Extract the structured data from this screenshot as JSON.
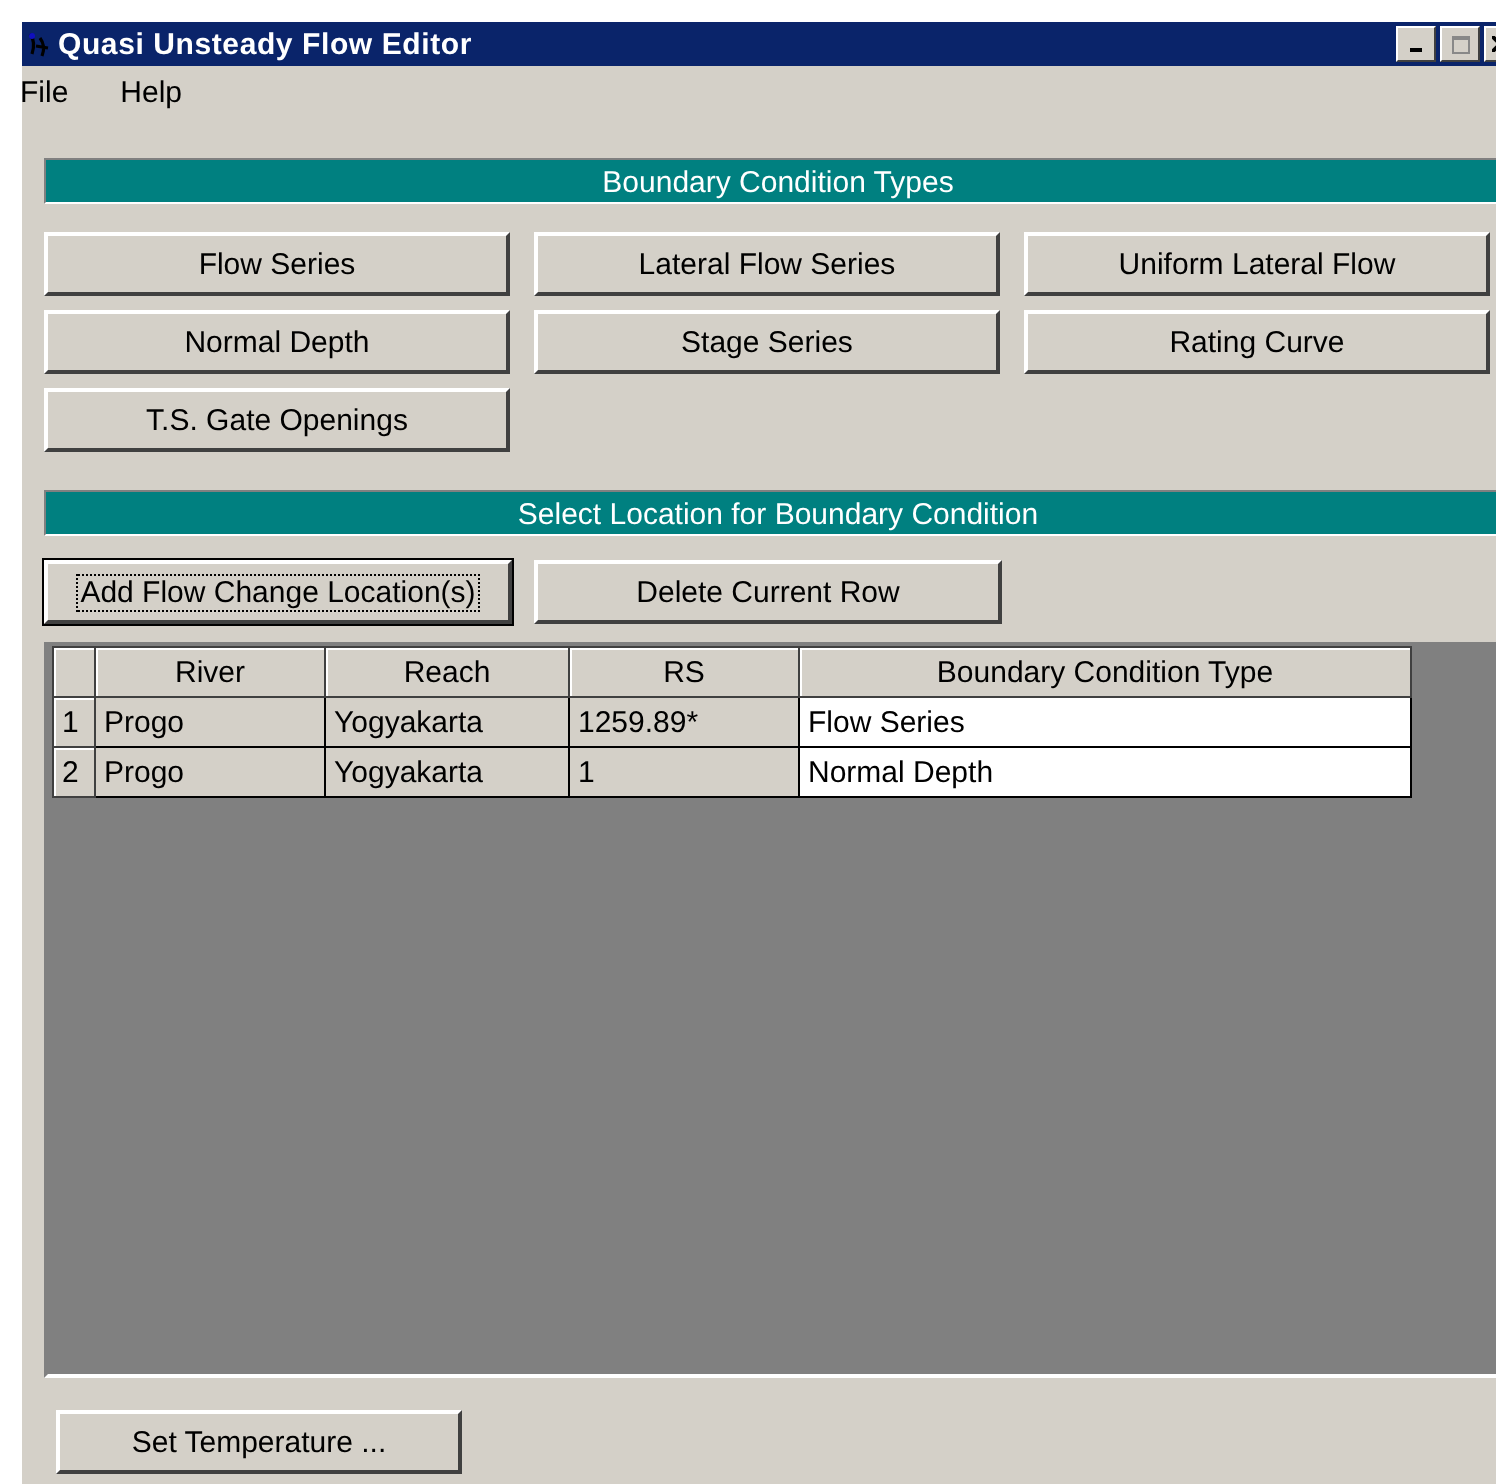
{
  "window": {
    "title": "Quasi Unsteady Flow Editor"
  },
  "menu": [
    "File",
    "Help"
  ],
  "boundary_types": {
    "heading": "Boundary Condition Types",
    "buttons": [
      "Flow Series",
      "Lateral Flow Series",
      "Uniform Lateral Flow",
      "Normal Depth",
      "Stage Series",
      "Rating Curve",
      "T.S. Gate Openings"
    ]
  },
  "location": {
    "heading": "Select Location for Boundary Condition",
    "buttons": [
      {
        "label": "Add Flow Change Location(s)",
        "focused": true
      },
      {
        "label": "Delete Current Row",
        "focused": false
      }
    ]
  },
  "table": {
    "columns": [
      {
        "label": "River",
        "editable": false
      },
      {
        "label": "Reach",
        "editable": false
      },
      {
        "label": "RS",
        "editable": false
      },
      {
        "label": "Boundary Condition Type",
        "editable": true
      }
    ],
    "rows": [
      {
        "number": "1",
        "cells": [
          "Progo",
          "Yogyakarta",
          "1259.89*",
          "Flow Series"
        ]
      },
      {
        "number": "2",
        "cells": [
          "Progo",
          "Yogyakarta",
          "1",
          "Normal Depth"
        ]
      }
    ]
  },
  "footer_button": "Set Temperature ..."
}
